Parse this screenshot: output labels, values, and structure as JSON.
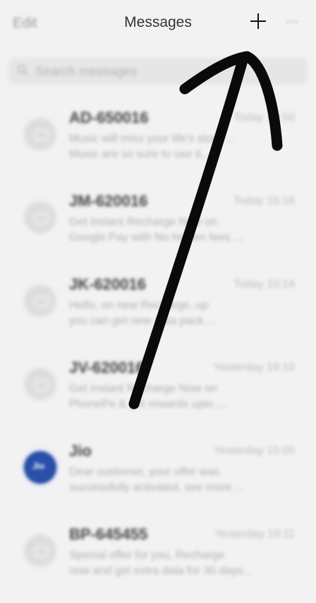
{
  "header": {
    "edit_label": "Edit",
    "title": "Messages",
    "new_label": "+",
    "more_label": "···"
  },
  "search": {
    "placeholder": "Search messages"
  },
  "conversations": [
    {
      "sender": "AD-650016",
      "time": "Today 15:50",
      "chevron": "›",
      "preview": [
        "Music will miss your life's story ...",
        "Music are so sure to use it..."
      ]
    },
    {
      "sender": "JM-620016",
      "time": "Today 15:16",
      "chevron": "›",
      "preview": [
        "Get instant Recharge Now on",
        "Google Pay with No hidden fees ..."
      ]
    },
    {
      "sender": "JK-620016",
      "time": "Today 10:14",
      "chevron": "›",
      "preview": [
        "Hello, on new Recharge, up",
        "you can get new data pack ..."
      ]
    },
    {
      "sender": "JV-620016",
      "time": "Yesterday 19:10",
      "chevron": "›",
      "preview": [
        "Get instant Recharge Now on",
        "PhonePe & get rewards upto ..."
      ]
    },
    {
      "sender": "Jio",
      "time": "Yesterday 15:05",
      "chevron": "›",
      "avatar": "Jio",
      "preview": [
        "Dear customer, your offer was",
        "successfully activated, see more ..."
      ]
    },
    {
      "sender": "BP-645455",
      "time": "Yesterday 19:11",
      "chevron": "›",
      "preview": [
        "Special offer for you, Recharge",
        "now and get extra data for 30 days..."
      ]
    }
  ],
  "colors": {
    "background": "#f2f2f2",
    "annotation": "#0a0a0a",
    "jio_avatar": "#2a4fa8"
  }
}
